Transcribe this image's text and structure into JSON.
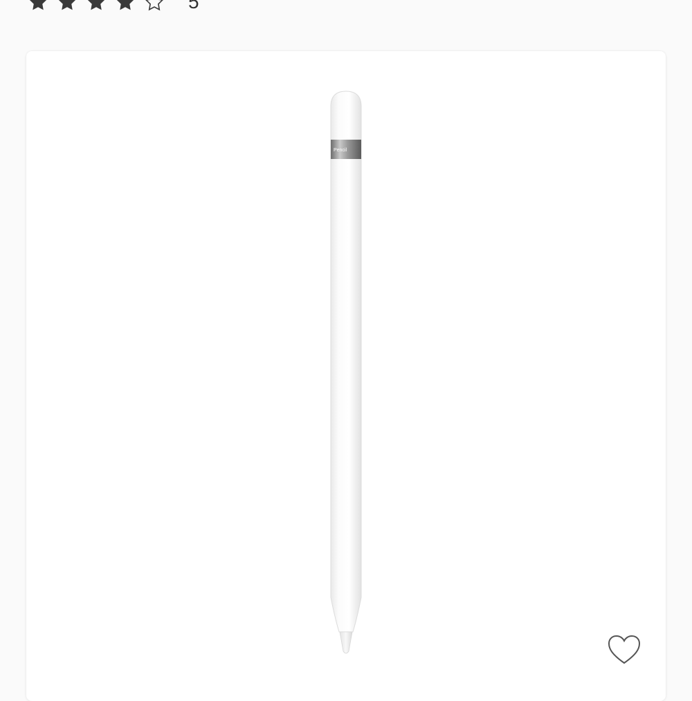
{
  "rating": {
    "value": 4,
    "max": 5,
    "count": "5"
  },
  "product": {
    "image_icon": "stylus-pencil-image",
    "pencil_band_text": "Pencil"
  },
  "favorite": {
    "icon": "heart-outline-icon"
  },
  "colors": {
    "star_filled": "#3a3a3a",
    "star_empty_stroke": "#3a3a3a",
    "card_background": "#ffffff",
    "page_background": "#fafafa",
    "heart_stroke": "#555555"
  }
}
